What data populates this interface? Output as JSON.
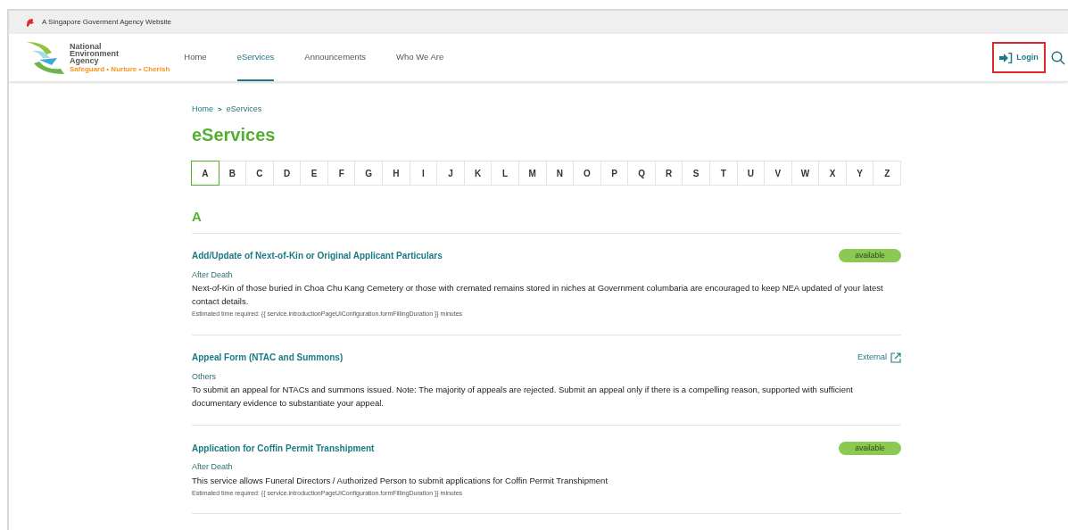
{
  "banner": {
    "text": "A Singapore Goverment Agency Website"
  },
  "logo": {
    "name_lines": [
      "National",
      "Environment",
      "Agency"
    ],
    "tagline": "Safeguard • Nurture • Cherish"
  },
  "nav": [
    {
      "label": "Home",
      "selected": false
    },
    {
      "label": "eServices",
      "selected": true
    },
    {
      "label": "Announcements",
      "selected": false
    },
    {
      "label": "Who We Are",
      "selected": false
    }
  ],
  "login": {
    "label": "Login"
  },
  "breadcrumb": [
    "Home",
    "eServices"
  ],
  "breadcrumb_separator": ">",
  "title": "eServices",
  "letters": [
    {
      "label": "A",
      "selected": true
    },
    {
      "label": "B",
      "selected": false
    },
    {
      "label": "C",
      "selected": false
    },
    {
      "label": "D",
      "selected": false
    },
    {
      "label": "E",
      "selected": false
    },
    {
      "label": "F",
      "selected": false
    },
    {
      "label": "G",
      "selected": false
    },
    {
      "label": "H",
      "selected": false
    },
    {
      "label": "I",
      "selected": false
    },
    {
      "label": "J",
      "selected": false
    },
    {
      "label": "K",
      "selected": false
    },
    {
      "label": "L",
      "selected": false
    },
    {
      "label": "M",
      "selected": false
    },
    {
      "label": "N",
      "selected": false
    },
    {
      "label": "O",
      "selected": false
    },
    {
      "label": "P",
      "selected": false
    },
    {
      "label": "Q",
      "selected": false
    },
    {
      "label": "R",
      "selected": false
    },
    {
      "label": "S",
      "selected": false
    },
    {
      "label": "T",
      "selected": false
    },
    {
      "label": "U",
      "selected": false
    },
    {
      "label": "V",
      "selected": false
    },
    {
      "label": "W",
      "selected": false
    },
    {
      "label": "X",
      "selected": false
    },
    {
      "label": "Y",
      "selected": false
    },
    {
      "label": "Z",
      "selected": false
    }
  ],
  "section_heading": "A",
  "services": [
    {
      "title": "Add/Update of Next-of-Kin or Original Applicant Particulars",
      "kind": "available",
      "tag": "available",
      "category": "After Death",
      "description": "Next-of-Kin of those buried in Choa Chu Kang Cemetery or those with cremated remains stored in niches at Government columbaria are encouraged to keep NEA updated of your latest contact details.",
      "estimate": "Estimated time required: {{ service.introductionPageUiConfiguration.formFillingDuration }} minutes"
    },
    {
      "title": "Appeal Form (NTAC and Summons)",
      "kind": "external",
      "tag": "External",
      "category": "Others",
      "description": "To submit an appeal for NTACs and summons issued. Note: The majority of appeals are rejected. Submit an appeal only if there is a compelling reason, supported with sufficient documentary evidence to substantiate your appeal."
    },
    {
      "title": "Application for Coffin Permit Transhipment",
      "kind": "available",
      "tag": "available",
      "category": "After Death",
      "description": "This service allows Funeral Directors / Authorized Person to submit applications for Coffin Permit Transhipment",
      "estimate": "Estimated time required: {{ service.introductionPageUiConfiguration.formFillingDuration }} minutes"
    }
  ]
}
